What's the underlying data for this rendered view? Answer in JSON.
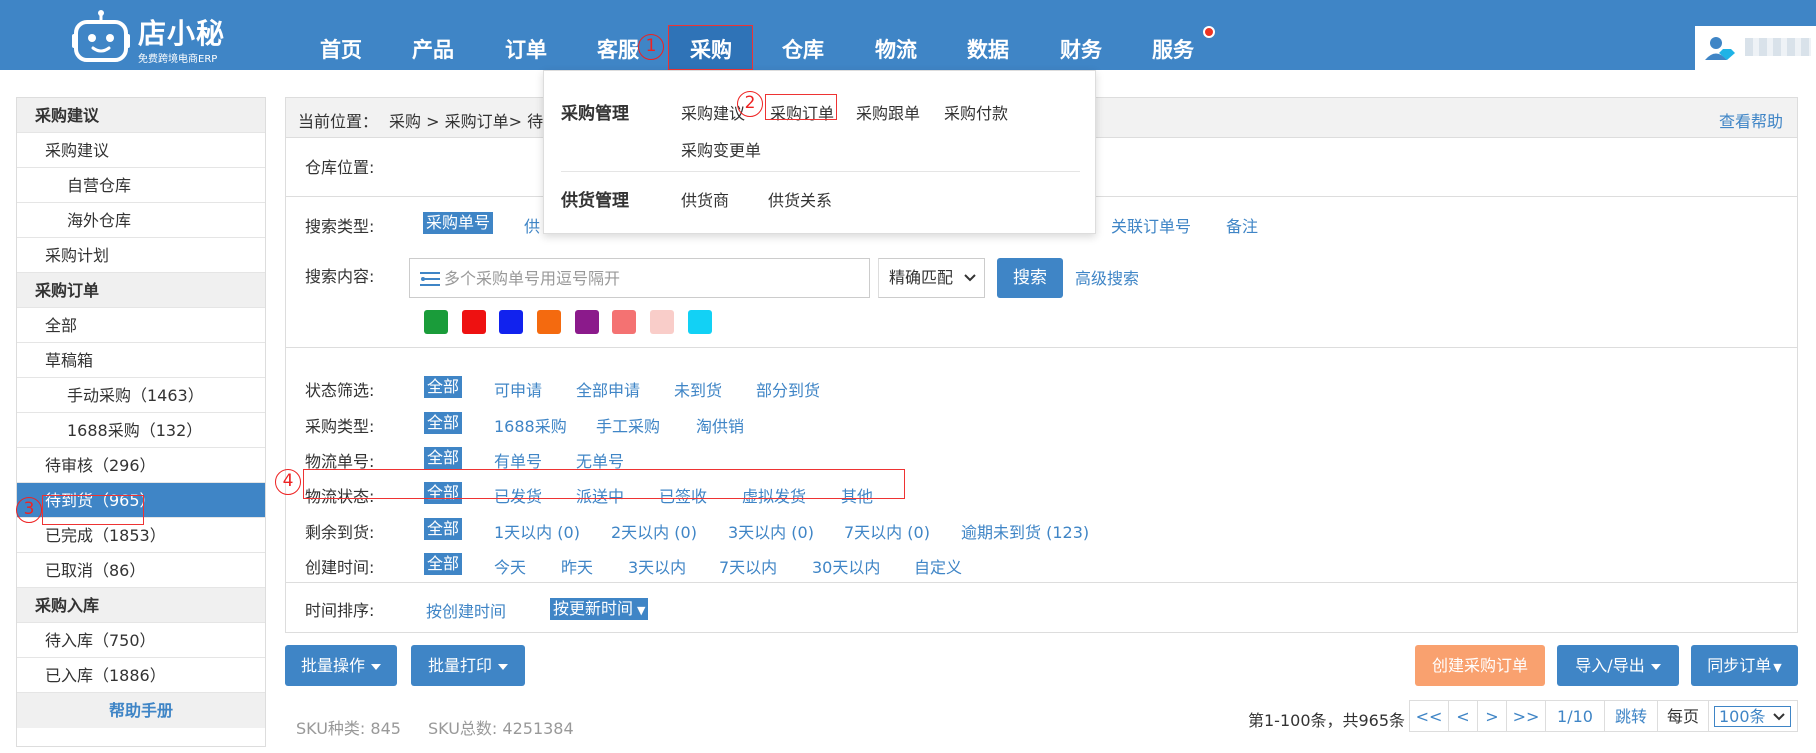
{
  "app": {
    "logo_name": "店小秘",
    "logo_sub": "免费跨境电商ERP"
  },
  "nav": {
    "items": [
      "首页",
      "产品",
      "订单",
      "客服",
      "采购",
      "仓库",
      "物流",
      "数据",
      "财务",
      "服务"
    ],
    "active": "采购"
  },
  "annotations": [
    "1",
    "2",
    "3",
    "4"
  ],
  "dropdown": {
    "group1_title": "采购管理",
    "group1_items": [
      "采购建议",
      "采购订单",
      "采购跟单",
      "采购付款",
      "采购变更单"
    ],
    "group2_title": "供货管理",
    "group2_items": [
      "供货商",
      "供货关系"
    ]
  },
  "sidebar": [
    {
      "label": "采购建议",
      "type": "header"
    },
    {
      "label": "采购建议",
      "type": "l1"
    },
    {
      "label": "自营仓库",
      "type": "l2"
    },
    {
      "label": "海外仓库",
      "type": "l2"
    },
    {
      "label": "采购计划",
      "type": "l1"
    },
    {
      "label": "采购订单",
      "type": "header"
    },
    {
      "label": "全部",
      "type": "l1"
    },
    {
      "label": "草稿箱",
      "type": "l1"
    },
    {
      "label": "手动采购（1463）",
      "type": "l2"
    },
    {
      "label": "1688采购（132）",
      "type": "l2"
    },
    {
      "label": "待审核（296）",
      "type": "l1"
    },
    {
      "label": "待到货（965）",
      "type": "l1",
      "active": true
    },
    {
      "label": "已完成（1853）",
      "type": "l1"
    },
    {
      "label": "已取消（86）",
      "type": "l1"
    },
    {
      "label": "采购入库",
      "type": "header"
    },
    {
      "label": "待入库（750）",
      "type": "l1"
    },
    {
      "label": "已入库（1886）",
      "type": "l1"
    },
    {
      "label": "帮助手册",
      "type": "help"
    }
  ],
  "breadcrumb": {
    "prefix": "当前位置：",
    "path": "采购 > 采购订单> 待到货",
    "help": "查看帮助"
  },
  "warehouse_label": "仓库位置:",
  "search": {
    "type_label": "搜索类型:",
    "types": [
      "采购单号",
      "供",
      "关联订单号",
      "备注"
    ],
    "content_label": "搜索内容:",
    "placeholder": "多个采购单号用逗号隔开",
    "match": "精确匹配",
    "button": "搜索",
    "advanced": "高级搜索"
  },
  "color_tags": [
    "#1a9c3a",
    "#ee1111",
    "#1122ee",
    "#f46a0f",
    "#8b1a8b",
    "#f47272",
    "#f9cdc9",
    "#12d1f5"
  ],
  "filters": [
    {
      "label": "状态筛选:",
      "options": [
        "全部",
        "可申请",
        "全部申请",
        "未到货",
        "部分到货"
      ]
    },
    {
      "label": "采购类型:",
      "options": [
        "全部",
        "1688采购",
        "手工采购",
        "淘供销"
      ]
    },
    {
      "label": "物流单号:",
      "options": [
        "全部",
        "有单号",
        "无单号"
      ]
    },
    {
      "label": "物流状态:",
      "options": [
        "全部",
        "已发货",
        "派送中",
        "已签收",
        "虚拟发货",
        "其他"
      ]
    },
    {
      "label": "剩余到货:",
      "options": [
        "全部",
        "1天以内 (0)",
        "2天以内 (0)",
        "3天以内 (0)",
        "7天以内 (0)",
        "逾期未到货 (123)"
      ]
    },
    {
      "label": "创建时间:",
      "options": [
        "全部",
        "今天",
        "昨天",
        "3天以内",
        "7天以内",
        "30天以内",
        "自定义"
      ]
    }
  ],
  "sort": {
    "label": "时间排序:",
    "options": [
      "按创建时间",
      "按更新时间"
    ]
  },
  "actions": {
    "batch_op": "批量操作",
    "batch_print": "批量打印",
    "create": "创建采购订单",
    "import_export": "导入/导出",
    "sync": "同步订单"
  },
  "stats": {
    "sku_kinds": "SKU种类: 845",
    "sku_total": "SKU总数: 4251384"
  },
  "pagination": {
    "summary": "第1-100条，共965条",
    "first": "<<",
    "prev": "<",
    "next": ">",
    "last": ">>",
    "page": "1/10",
    "jump": "跳转",
    "per_page_label": "每页",
    "per_page": "100条"
  }
}
